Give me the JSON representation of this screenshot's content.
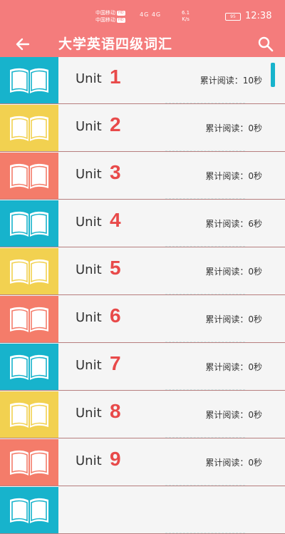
{
  "status_bar": {
    "carrier_1": "中国移动",
    "carrier_2": "中国移动",
    "hd_1": "HD",
    "hd_2": "HD",
    "signal_text": "4G 4G",
    "speed_value": "6.1",
    "speed_unit": "K/s",
    "battery": "95",
    "time": "12:38"
  },
  "app_bar": {
    "title": "大学英语四级词汇",
    "back_icon": "arrow-left-icon",
    "search_icon": "search-icon"
  },
  "colors": {
    "primary": "#f47c7c",
    "number": "#e84a4a",
    "teal": "#17b3cc",
    "yellow": "#f2d150",
    "coral": "#f47c6a",
    "scroll": "#17b3cc"
  },
  "units": [
    {
      "label": "Unit",
      "number": "1",
      "read": "累计阅读：10秒",
      "color": "#17b3cc"
    },
    {
      "label": "Unit",
      "number": "2",
      "read": "累计阅读：0秒",
      "color": "#f2d150"
    },
    {
      "label": "Unit",
      "number": "3",
      "read": "累计阅读：0秒",
      "color": "#f47c6a"
    },
    {
      "label": "Unit",
      "number": "4",
      "read": "累计阅读：6秒",
      "color": "#17b3cc"
    },
    {
      "label": "Unit",
      "number": "5",
      "read": "累计阅读：0秒",
      "color": "#f2d150"
    },
    {
      "label": "Unit",
      "number": "6",
      "read": "累计阅读：0秒",
      "color": "#f47c6a"
    },
    {
      "label": "Unit",
      "number": "7",
      "read": "累计阅读：0秒",
      "color": "#17b3cc"
    },
    {
      "label": "Unit",
      "number": "8",
      "read": "累计阅读：0秒",
      "color": "#f2d150"
    },
    {
      "label": "Unit",
      "number": "9",
      "read": "累计阅读：0秒",
      "color": "#f47c6a"
    },
    {
      "label": "",
      "number": "",
      "read": "",
      "color": "#17b3cc"
    }
  ]
}
